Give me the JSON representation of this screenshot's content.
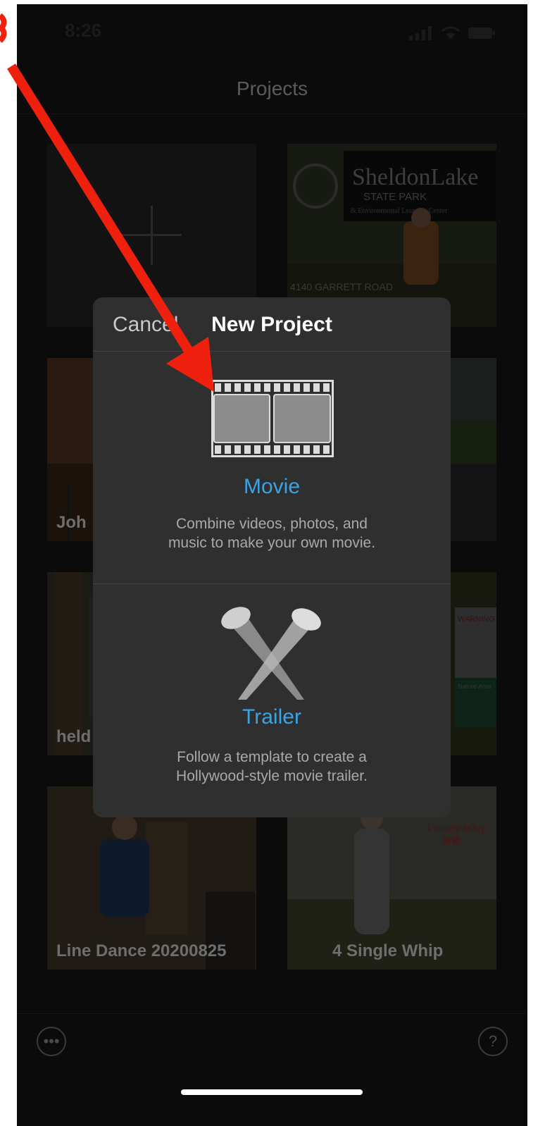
{
  "status": {
    "time": "8:26"
  },
  "nav": {
    "title": "Projects"
  },
  "projects": [
    {
      "label": ""
    },
    {
      "label": "Joh"
    },
    {
      "label": "held"
    },
    {
      "label": "Line Dance 20200825"
    },
    {
      "label": "4 Single Whip"
    }
  ],
  "thumb_text": {
    "sign_line1": "SheldonLake",
    "sign_line2": "STATE PARK",
    "sign_line3": "& Environmental Learning Center",
    "road": "4140 GARRETT ROAD",
    "warning": "WARNING",
    "nature": "Nature Area",
    "whip_title": "4 Single Whip",
    "whip_cn": "單鞭"
  },
  "dialog": {
    "cancel_label": "Cancel",
    "title": "New Project",
    "options": [
      {
        "title": "Movie",
        "desc_line1": "Combine videos, photos, and",
        "desc_line2": "music to make your own movie."
      },
      {
        "title": "Trailer",
        "desc_line1": "Follow a template to create a",
        "desc_line2": "Hollywood-style movie trailer."
      }
    ]
  },
  "colors": {
    "accent": "#3aa3e3",
    "annotation": "#f0200f",
    "sheet": "#2f2f30"
  }
}
